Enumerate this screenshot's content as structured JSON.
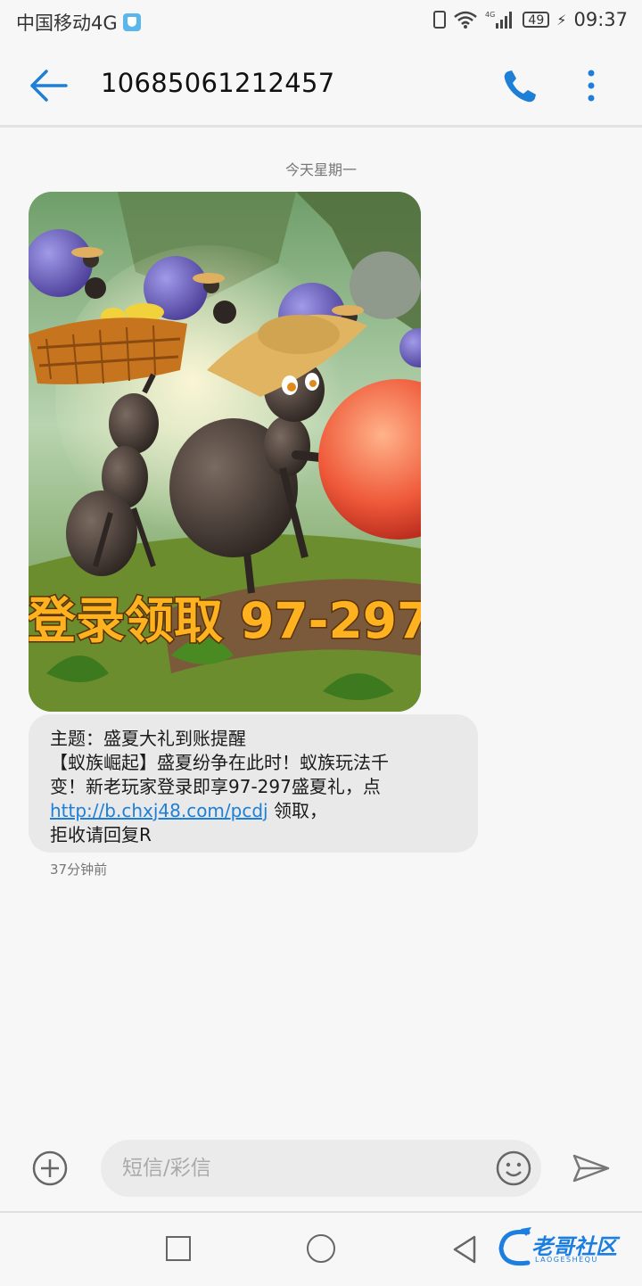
{
  "status_bar": {
    "carrier": "中国移动4G",
    "net": "4G",
    "battery": "49",
    "time": "09:37"
  },
  "header": {
    "contact": "10685061212457"
  },
  "conversation": {
    "date_separator": "今天星期一",
    "image": {
      "banner_text": "登录领取 97-297"
    },
    "message": {
      "subject": "主题：盛夏大礼到账提醒",
      "body_line1": "【蚁族崛起】盛夏纷争在此时！蚁族玩法千",
      "body_line2": "变！新老玩家登录即享97-297盛夏礼，点",
      "link": "http://b.chxj48.com/pcdj",
      "body_after_link": " 领取，",
      "body_line4": "拒收请回复R"
    },
    "time_ago": "37分钟前"
  },
  "input_bar": {
    "placeholder": "短信/彩信"
  },
  "watermark": {
    "text": "老哥社区",
    "sub": "LAOGESHEQU"
  },
  "colors": {
    "accent": "#1d7fd6",
    "bubble": "#e9e9e9",
    "background": "#f7f7f7"
  }
}
